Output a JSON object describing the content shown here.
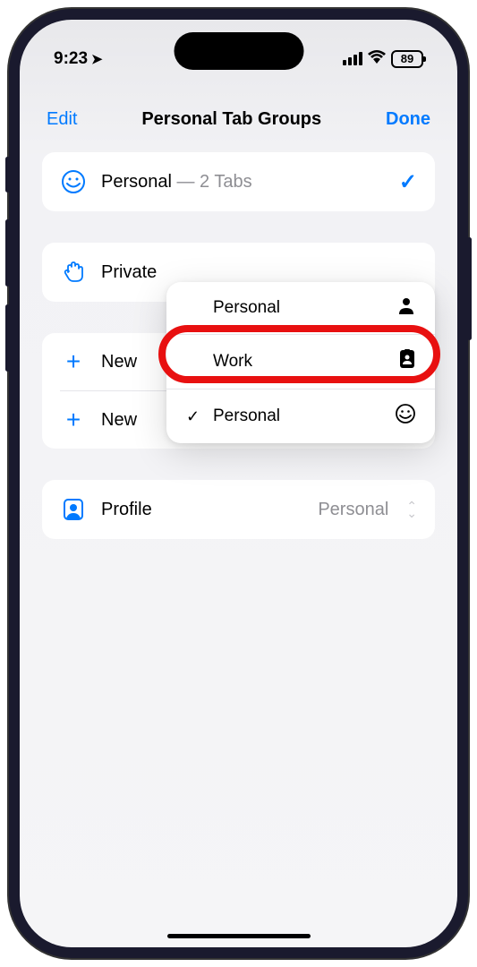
{
  "status": {
    "time": "9:23",
    "battery": "89"
  },
  "nav": {
    "left": "Edit",
    "title": "Personal Tab Groups",
    "right": "Done"
  },
  "groups": {
    "personal": {
      "label": "Personal",
      "sublabel": " — 2 Tabs"
    },
    "private": {
      "label": "Private"
    }
  },
  "new": {
    "item1": "New",
    "item2": "New"
  },
  "profile": {
    "label": "Profile",
    "value": "Personal"
  },
  "popup": {
    "items": [
      {
        "label": "Personal",
        "checked": false,
        "icon": "person"
      },
      {
        "label": "Work",
        "checked": false,
        "icon": "badge"
      },
      {
        "label": "Personal",
        "checked": true,
        "icon": "smiley"
      }
    ]
  }
}
